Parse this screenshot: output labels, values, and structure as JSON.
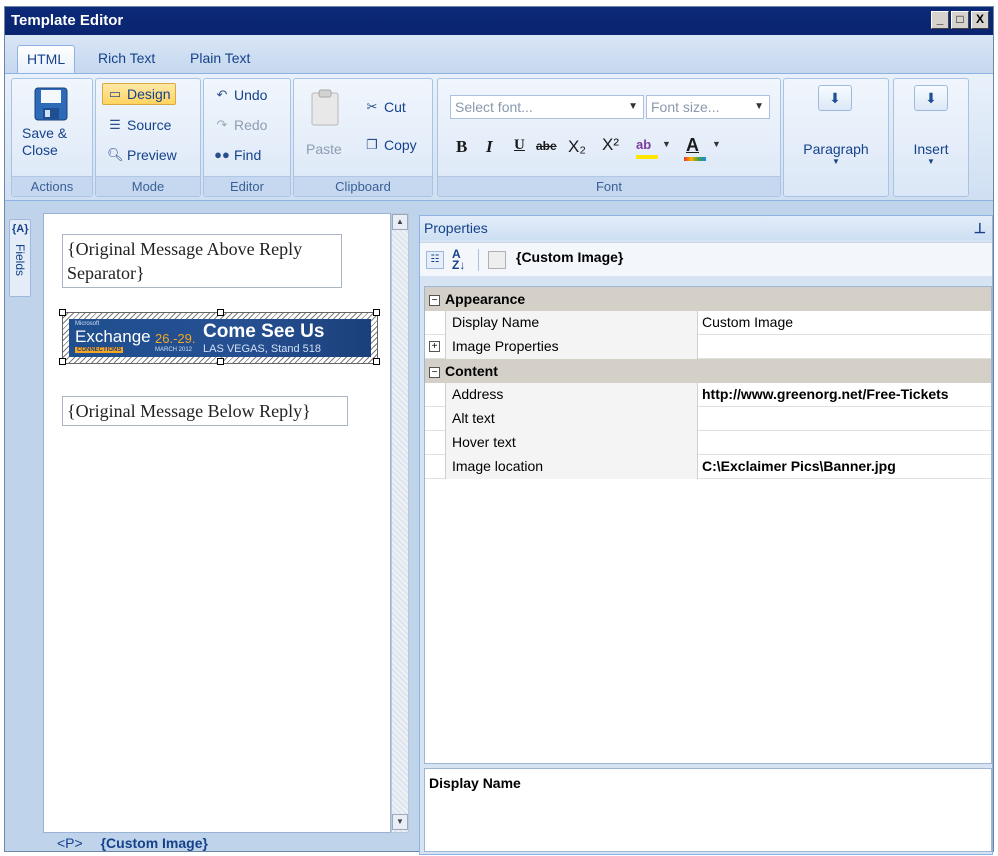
{
  "window": {
    "title": "Template Editor",
    "buttons": [
      "_",
      "□",
      "X"
    ]
  },
  "tabs": [
    "HTML",
    "Rich Text",
    "Plain Text"
  ],
  "ribbon": {
    "actions": {
      "save_close": "Save &\nClose",
      "group": "Actions"
    },
    "mode": {
      "design": "Design",
      "source": "Source",
      "preview": "Preview",
      "group": "Mode"
    },
    "editor": {
      "undo": "Undo",
      "redo": "Redo",
      "find": "Find",
      "group": "Editor"
    },
    "clipboard": {
      "paste": "Paste",
      "cut": "Cut",
      "copy": "Copy",
      "group": "Clipboard"
    },
    "font": {
      "font_placeholder": "Select font...",
      "size_placeholder": "Font size...",
      "group": "Font",
      "bold": "B",
      "italic": "I",
      "underline": "U",
      "strike": "abe",
      "sub": "X₂",
      "sup": "X²"
    },
    "paragraph": "Paragraph",
    "insert": "Insert"
  },
  "sidebar": {
    "fields_label": "Fields",
    "icon_label": "{A}"
  },
  "editor": {
    "placeholder_above": "{Original Message Above Reply Separator}",
    "placeholder_below": "{Original Message Below Reply}",
    "banner": {
      "brand_small": "Microsoft",
      "brand": "Exchange",
      "dates": "26.-29.",
      "month": "MARCH 2012",
      "connections": "CONNECTIONS",
      "headline": "Come See Us",
      "location": "LAS VEGAS, Stand 518"
    }
  },
  "statusbar": {
    "tag": "<P>",
    "element": "{Custom Image}"
  },
  "properties": {
    "title": "Properties",
    "pin": "ᵽ",
    "selected": "{Custom Image}",
    "categories": [
      {
        "name": "Appearance",
        "rows": [
          {
            "name": "Display Name",
            "value": "Custom Image",
            "expand": false,
            "bold": false
          },
          {
            "name": "Image Properties",
            "value": "",
            "expand": true,
            "bold": false
          }
        ]
      },
      {
        "name": "Content",
        "rows": [
          {
            "name": "Address",
            "value": "http://www.greenorg.net/Free-Tickets",
            "expand": false,
            "bold": true
          },
          {
            "name": "Alt text",
            "value": "",
            "expand": false,
            "bold": false
          },
          {
            "name": "Hover text",
            "value": "",
            "expand": false,
            "bold": false
          },
          {
            "name": "Image location",
            "value": "C:\\Exclaimer Pics\\Banner.jpg",
            "expand": false,
            "bold": true
          }
        ]
      }
    ],
    "description": "Display Name"
  }
}
